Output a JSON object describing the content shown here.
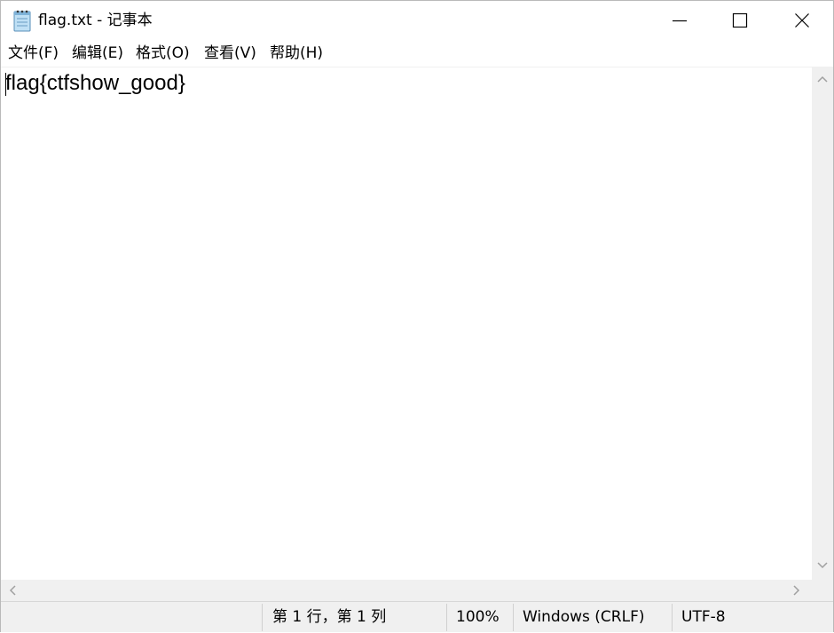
{
  "window": {
    "title": "flag.txt - 记事本",
    "icon": "notepad-icon",
    "controls": [
      "minimize-icon",
      "maximize-icon",
      "close-icon"
    ]
  },
  "menu": {
    "file": "文件(F)",
    "edit": "编辑(E)",
    "format": "格式(O)",
    "view": "查看(V)",
    "help": "帮助(H)"
  },
  "editor": {
    "content": "flag{ctfshow_good}"
  },
  "status": {
    "position": "第 1 行，第 1 列",
    "zoom": "100%",
    "line_ending": "Windows (CRLF)",
    "encoding": "UTF-8"
  },
  "colors": {
    "chrome_bg": "#f0f0f0",
    "editor_bg": "#ffffff",
    "text": "#000000"
  }
}
